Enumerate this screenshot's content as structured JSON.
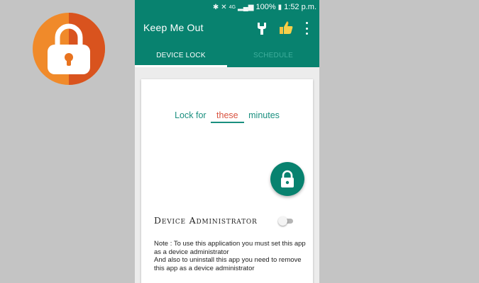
{
  "status_bar": {
    "battery_percent": "100%",
    "time": "1:52 p.m.",
    "network": "4G",
    "icons": [
      "bluetooth-icon",
      "mute-icon",
      "signal-icon",
      "battery-icon"
    ]
  },
  "app_bar": {
    "title": "Keep Me Out",
    "actions": [
      "wrench-icon",
      "thumbs-up-icon",
      "overflow-menu-icon"
    ]
  },
  "tabs": [
    {
      "label": "DEVICE LOCK",
      "active": true
    },
    {
      "label": "SCHEDULE",
      "active": false
    }
  ],
  "lock": {
    "prefix": "Lock for",
    "value": "these",
    "suffix": "minutes"
  },
  "admin": {
    "label": "Device Administrator",
    "enabled": false
  },
  "note": {
    "line1": "Note : To use this application you must set this app as a device administrator",
    "line2": "And also to uninstall this app you need to remove this app as a device administrator"
  },
  "colors": {
    "primary": "#08826f",
    "accent_text": "#d9523f",
    "logo_orange": "#e8731f",
    "background": "#c4c4c4"
  }
}
